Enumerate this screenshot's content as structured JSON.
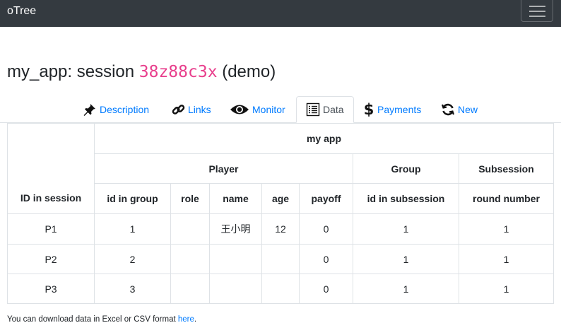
{
  "navbar": {
    "brand": "oTree",
    "menu_icon": "hamburger-menu-icon"
  },
  "page": {
    "title_prefix": "my_app: session ",
    "session_code": "38z88c3x",
    "title_suffix": " (demo)"
  },
  "tabs": [
    {
      "label": "Description",
      "icon": "pin-icon",
      "active": false
    },
    {
      "label": "Links",
      "icon": "link-icon",
      "active": false
    },
    {
      "label": "Monitor",
      "icon": "eye-icon",
      "active": false
    },
    {
      "label": "Data",
      "icon": "table-list-icon",
      "active": true
    },
    {
      "label": "Payments",
      "icon": "dollar-icon",
      "active": false
    },
    {
      "label": "New",
      "icon": "refresh-icon",
      "active": false
    }
  ],
  "table": {
    "app_header": "my app",
    "groups": [
      "Player",
      "Group",
      "Subsession"
    ],
    "id_header": "ID in session",
    "columns": [
      "id in group",
      "role",
      "name",
      "age",
      "payoff",
      "id in subsession",
      "round number"
    ],
    "rows": [
      {
        "id": "P1",
        "cells": [
          "1",
          "",
          "王小明",
          "12",
          "0",
          "1",
          "1"
        ]
      },
      {
        "id": "P2",
        "cells": [
          "2",
          "",
          "",
          "",
          "0",
          "1",
          "1"
        ]
      },
      {
        "id": "P3",
        "cells": [
          "3",
          "",
          "",
          "",
          "0",
          "1",
          "1"
        ]
      }
    ]
  },
  "footer": {
    "text": "You can download data in Excel or CSV format ",
    "link": "here",
    "end": "."
  },
  "colors": {
    "navbar": "#343a40",
    "link": "#007bff",
    "code": "#e83e8c",
    "border": "#dee2e6"
  }
}
